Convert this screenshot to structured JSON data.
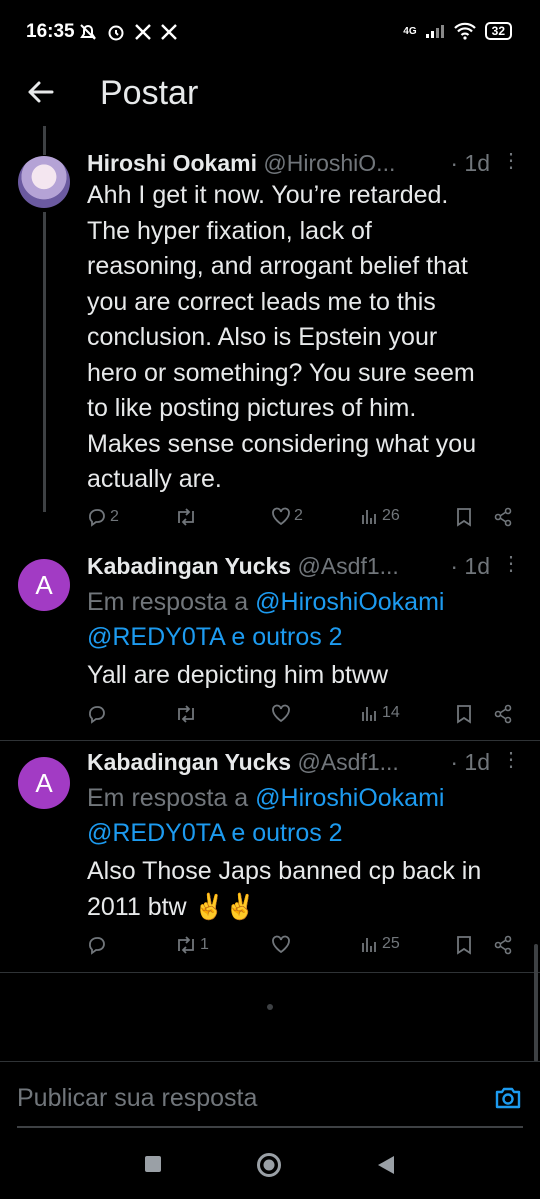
{
  "status": {
    "time": "16:35",
    "network": "4G",
    "battery": "32"
  },
  "header": {
    "title": "Postar"
  },
  "posts": [
    {
      "name": "Hiroshi Ookami",
      "handle": "@HiroshiO...",
      "time": "· 1d",
      "lines": [
        "Ahh I get it now. You’re retarded.",
        "The hyper fixation, lack of",
        "reasoning, and arrogant belief that",
        "you are correct leads me to this",
        "conclusion. Also is Epstein your",
        "hero or something? You sure seem",
        "to like posting pictures of him.",
        "Makes sense considering what you",
        "actually are."
      ],
      "replies": "2",
      "reposts": "",
      "likes": "2",
      "views": "26"
    },
    {
      "name": "Kabadingan Yucks",
      "handle": "@Asdf1...",
      "time": "· 1d",
      "avatar_letter": "A",
      "reply_prefix": "Em resposta a ",
      "reply_user": "@HiroshiOokami",
      "reply_line2": "@REDY0TA e outros 2",
      "lines": [
        "Yall are depicting him btww"
      ],
      "replies": "",
      "reposts": "",
      "likes": "",
      "views": "14"
    },
    {
      "name": "Kabadingan Yucks",
      "handle": "@Asdf1...",
      "time": "· 1d",
      "avatar_letter": "A",
      "reply_prefix": "Em resposta a ",
      "reply_user": "@HiroshiOokami",
      "reply_line2": "@REDY0TA e outros 2",
      "lines": [
        "Also Those Japs banned cp back in",
        "2011 btw ✌️✌️"
      ],
      "replies": "",
      "reposts": "1",
      "likes": "",
      "views": "25"
    }
  ],
  "composer": {
    "placeholder": "Publicar sua resposta"
  },
  "colors": {
    "accent": "#1d9bf0",
    "secondary_text": "#71767b",
    "avatar_bg": "#a23bc4"
  },
  "icons": [
    "back-arrow-icon",
    "reply-icon",
    "repost-icon",
    "like-icon",
    "views-icon",
    "bookmark-icon",
    "share-icon",
    "more-icon",
    "camera-icon"
  ]
}
